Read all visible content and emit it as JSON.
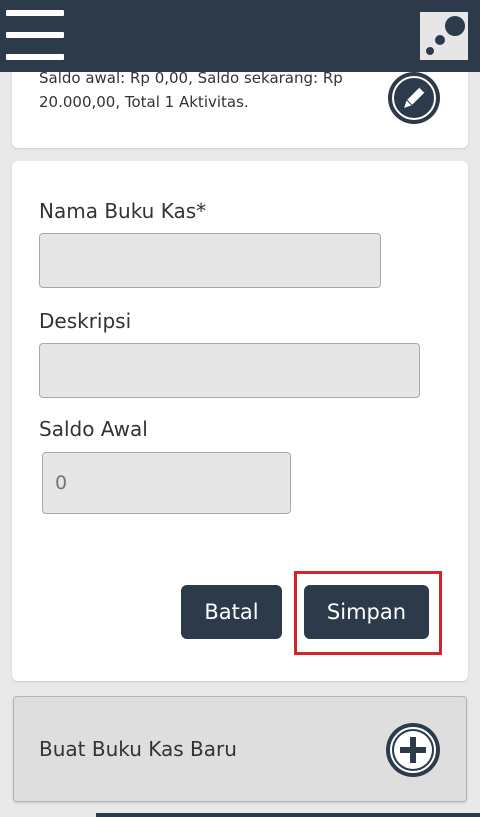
{
  "header": {
    "menu_icon": "hamburger-menu-icon",
    "logo_icon": "app-logo-icon"
  },
  "summary": {
    "text": "Saldo awal: Rp 0,00, Saldo sekarang: Rp 20.000,00, Total 1 Aktivitas.",
    "edit_icon": "pencil-icon"
  },
  "form": {
    "name_label": "Nama Buku Kas*",
    "name_value": "",
    "description_label": "Deskripsi",
    "description_value": "",
    "initial_balance_label": "Saldo Awal",
    "initial_balance_placeholder": "0",
    "cancel_label": "Batal",
    "save_label": "Simpan"
  },
  "create_new": {
    "label": "Buat Buku Kas Baru",
    "icon": "plus-circle-icon"
  },
  "colors": {
    "primary": "#2c3a4a",
    "highlight": "#d4242a",
    "input_bg": "#e6e6e6"
  }
}
